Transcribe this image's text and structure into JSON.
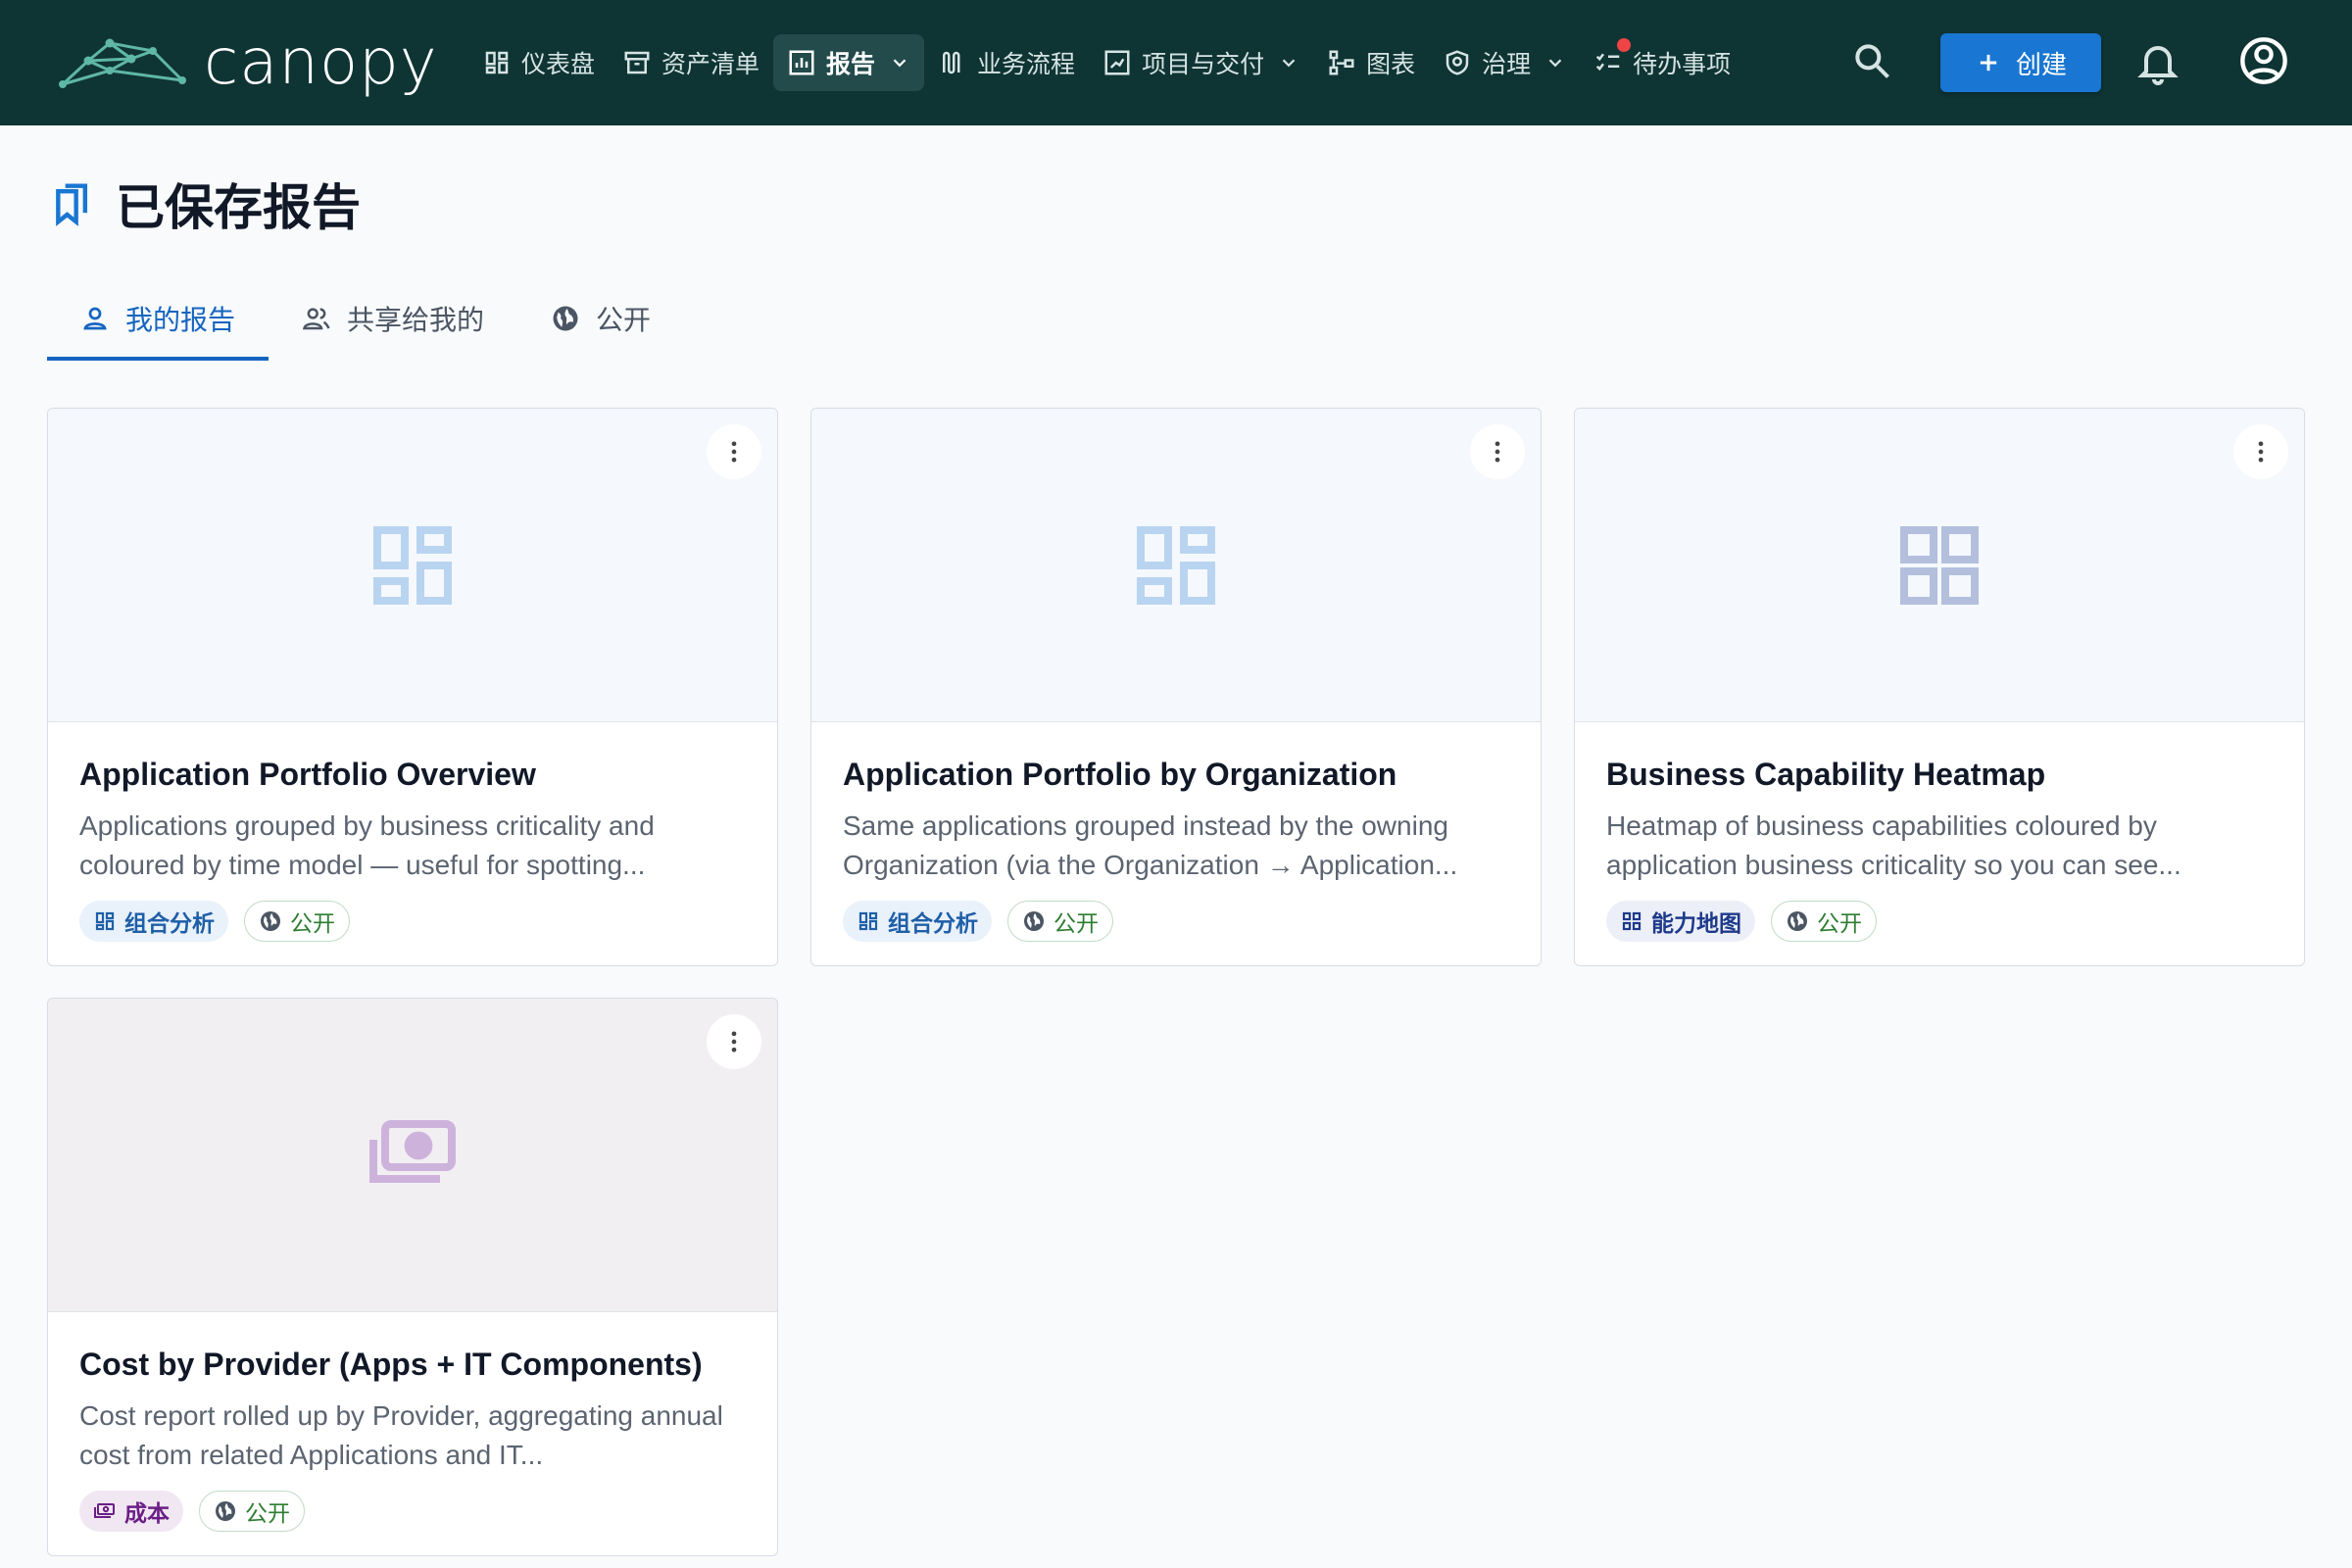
{
  "app": {
    "name": "canopy"
  },
  "nav": {
    "items": [
      {
        "label": "仪表盘",
        "icon": "dashboard-icon"
      },
      {
        "label": "资产清单",
        "icon": "inventory-icon"
      },
      {
        "label": "报告",
        "icon": "reports-icon",
        "active": true,
        "dropdown": true
      },
      {
        "label": "业务流程",
        "icon": "process-icon"
      },
      {
        "label": "项目与交付",
        "icon": "projects-icon",
        "dropdown": true
      },
      {
        "label": "图表",
        "icon": "diagram-icon"
      },
      {
        "label": "治理",
        "icon": "governance-icon",
        "dropdown": true
      },
      {
        "label": "待办事项",
        "icon": "todo-icon",
        "has_notification_dot": true
      }
    ],
    "create_label": "创建"
  },
  "page": {
    "title": "已保存报告"
  },
  "tabs": [
    {
      "label": "我的报告",
      "active": true,
      "icon": "person-icon"
    },
    {
      "label": "共享给我的",
      "active": false,
      "icon": "people-icon"
    },
    {
      "label": "公开",
      "active": false,
      "icon": "globe-icon"
    }
  ],
  "cards": [
    {
      "title": "Application Portfolio Overview",
      "description": "Applications grouped by business criticality and coloured by time model — useful for spotting...",
      "type_label": "组合分析",
      "visibility_label": "公开",
      "thumb_icon": "grid-icon"
    },
    {
      "title": "Application Portfolio by Organization",
      "description": "Same applications grouped instead by the owning Organization (via the Organization → Application...",
      "type_label": "组合分析",
      "visibility_label": "公开",
      "thumb_icon": "grid-icon"
    },
    {
      "title": "Business Capability Heatmap",
      "description": "Heatmap of business capabilities coloured by application business criticality so you can see...",
      "type_label": "能力地图",
      "visibility_label": "公开",
      "thumb_icon": "grid-icon"
    },
    {
      "title": "Cost by Provider (Apps + IT Components)",
      "description": "Cost report rolled up by Provider, aggregating annual cost from related Applications and IT...",
      "type_label": "成本",
      "visibility_label": "公开",
      "thumb_icon": "money-icon"
    }
  ],
  "colors": {
    "topbar": "#0f3434",
    "accent": "#1976d2",
    "public_green": "#2e7d32",
    "notification_red": "#ef4444"
  }
}
